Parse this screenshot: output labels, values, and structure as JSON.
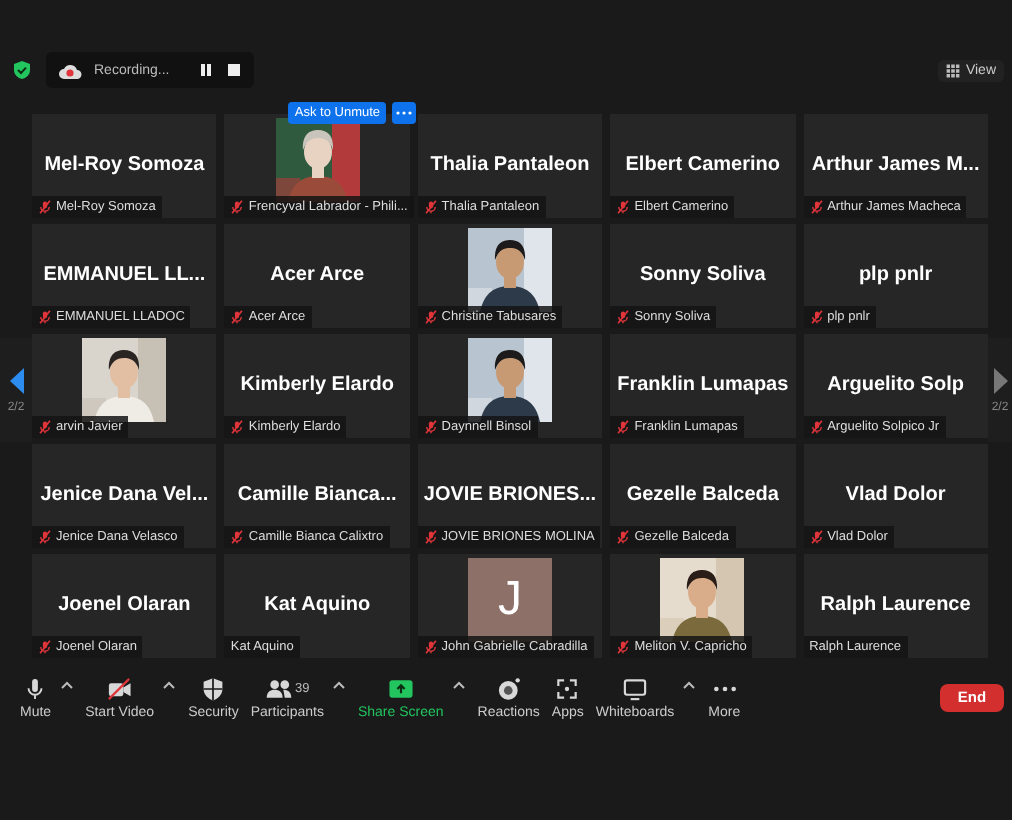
{
  "top_bar": {
    "recording": {
      "label": "Recording..."
    },
    "view_label": "View"
  },
  "tiles": [
    {
      "kind": "name",
      "display": "Mel-Roy Somoza",
      "label": "Mel-Roy Somoza",
      "muted": true
    },
    {
      "kind": "picture",
      "label": "Frencyval Labrador - Phili...",
      "muted": true,
      "overlay": {
        "button": "Ask to Unmute"
      }
    },
    {
      "kind": "name",
      "display": "Thalia Pantaleon",
      "label": "Thalia Pantaleon",
      "muted": true
    },
    {
      "kind": "name",
      "display": "Elbert Camerino",
      "label": "Elbert Camerino",
      "muted": true
    },
    {
      "kind": "name",
      "display": "Arthur James M...",
      "label": "Arthur James Macheca",
      "muted": true
    },
    {
      "kind": "name",
      "display": "EMMANUEL LL...",
      "label": "EMMANUEL LLADOC",
      "muted": true
    },
    {
      "kind": "name",
      "display": "Acer Arce",
      "label": "Acer Arce",
      "muted": true
    },
    {
      "kind": "picture",
      "label": "Christine Tabusares",
      "muted": true
    },
    {
      "kind": "name",
      "display": "Sonny Soliva",
      "label": "Sonny Soliva",
      "muted": true
    },
    {
      "kind": "name",
      "display": "plp pnlr",
      "label": "plp pnlr",
      "muted": true
    },
    {
      "kind": "picture",
      "label": "arvin Javier",
      "muted": true
    },
    {
      "kind": "name",
      "display": "Kimberly Elardo",
      "label": "Kimberly Elardo",
      "muted": true
    },
    {
      "kind": "picture",
      "label": "Daynnell Binsol",
      "muted": true
    },
    {
      "kind": "name",
      "display": "Franklin Lumapas",
      "label": "Franklin Lumapas",
      "muted": true
    },
    {
      "kind": "name",
      "display": "Arguelito Solp",
      "label": "Arguelito Solpico Jr",
      "muted": true
    },
    {
      "kind": "name",
      "display": "Jenice Dana Vel...",
      "label": "Jenice Dana Velasco",
      "muted": true
    },
    {
      "kind": "name",
      "display": "Camille Bianca...",
      "label": "Camille Bianca Calixtro",
      "muted": true
    },
    {
      "kind": "name",
      "display": "JOVIE BRIONES...",
      "label": "JOVIE BRIONES MOLINA",
      "muted": true
    },
    {
      "kind": "name",
      "display": "Gezelle Balceda",
      "label": "Gezelle Balceda",
      "muted": true
    },
    {
      "kind": "name",
      "display": "Vlad Dolor",
      "label": "Vlad Dolor",
      "muted": true
    },
    {
      "kind": "name",
      "display": "Joenel Olaran",
      "label": "Joenel Olaran",
      "muted": true
    },
    {
      "kind": "name",
      "display": "Kat Aquino",
      "label": "Kat Aquino",
      "muted": false
    },
    {
      "kind": "avatar",
      "initial": "J",
      "color": "#8d7068",
      "label": "John Gabrielle Cabradilla",
      "muted": true
    },
    {
      "kind": "picture",
      "label": "Meliton V. Capricho",
      "muted": true
    },
    {
      "kind": "name",
      "display": "Ralph Laurence",
      "label": "Ralph Laurence",
      "muted": false
    }
  ],
  "pager": {
    "left": {
      "page": "2/2",
      "disabled": false
    },
    "right": {
      "page": "2/2",
      "disabled": true
    }
  },
  "toolbar": [
    {
      "kind": "mic",
      "label": "Mute",
      "caret": true
    },
    {
      "kind": "video_off",
      "label": "Start Video",
      "caret": true
    },
    {
      "kind": "security",
      "label": "Security",
      "caret": false
    },
    {
      "kind": "participants",
      "label": "Participants",
      "count": "39",
      "caret": true
    },
    {
      "kind": "share",
      "label": "Share Screen",
      "caret": true,
      "highlighted": true
    },
    {
      "kind": "reactions",
      "label": "Reactions",
      "caret": false
    },
    {
      "kind": "apps",
      "label": "Apps",
      "caret": false
    },
    {
      "kind": "whiteboard",
      "label": "Whiteboards",
      "caret": true
    },
    {
      "kind": "more",
      "label": "More",
      "caret": false
    }
  ],
  "end_button": "End"
}
